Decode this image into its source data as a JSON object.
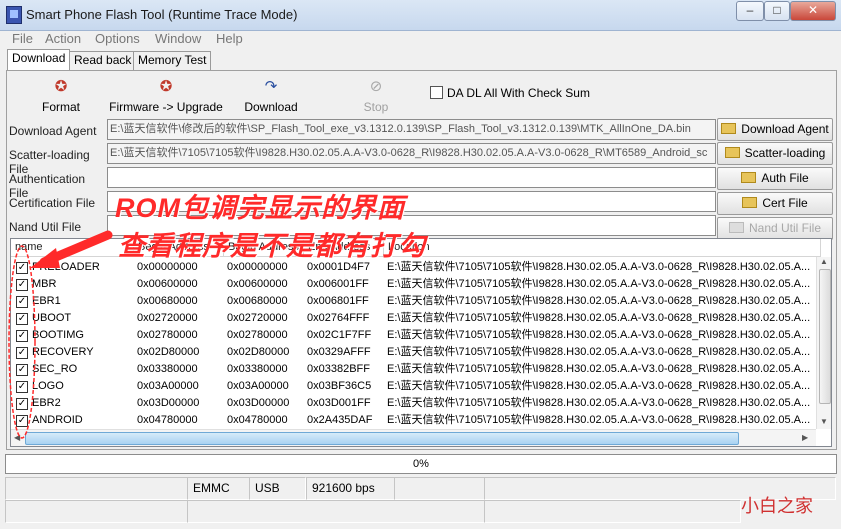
{
  "window": {
    "title": "Smart Phone Flash Tool (Runtime Trace Mode)"
  },
  "menu": [
    "File",
    "Action",
    "Options",
    "Window",
    "Help"
  ],
  "tabs": [
    "Download",
    "Read back",
    "Memory Test"
  ],
  "toolbar": {
    "format": "Format",
    "firmware_upgrade": "Firmware -> Upgrade",
    "download": "Download",
    "stop": "Stop",
    "da_checkbox": "DA DL All With Check Sum",
    "da_checked": false
  },
  "fields": {
    "download_agent": {
      "label": "Download Agent",
      "value": "E:\\蓝天信软件\\修改后的软件\\SP_Flash_Tool_exe_v3.1312.0.139\\SP_Flash_Tool_v3.1312.0.139\\MTK_AllInOne_DA.bin",
      "button": "Download Agent"
    },
    "scatter": {
      "label": "Scatter-loading File",
      "value": "E:\\蓝天信软件\\7105\\7105软件\\I9828.H30.02.05.A.A-V3.0-0628_R\\I9828.H30.02.05.A.A-V3.0-0628_R\\MT6589_Android_sc",
      "button": "Scatter-loading"
    },
    "auth": {
      "label": "Authentication File",
      "value": "",
      "button": "Auth File"
    },
    "cert": {
      "label": "Certification File",
      "value": "",
      "button": "Cert File"
    },
    "nand": {
      "label": "Nand Util File",
      "value": "",
      "button": "Nand Util File"
    }
  },
  "table": {
    "headers": [
      "name",
      "Begin Address",
      "Begin Address",
      "End Address",
      "Location"
    ],
    "rows": [
      {
        "name": "PRELOADER",
        "a1": "0x00000000",
        "a2": "0x00000000",
        "end": "0x0001D4F7",
        "loc": "E:\\蓝天信软件\\7105\\7105软件\\I9828.H30.02.05.A.A-V3.0-0628_R\\I9828.H30.02.05.A..."
      },
      {
        "name": "MBR",
        "a1": "0x00600000",
        "a2": "0x00600000",
        "end": "0x006001FF",
        "loc": "E:\\蓝天信软件\\7105\\7105软件\\I9828.H30.02.05.A.A-V3.0-0628_R\\I9828.H30.02.05.A..."
      },
      {
        "name": "EBR1",
        "a1": "0x00680000",
        "a2": "0x00680000",
        "end": "0x006801FF",
        "loc": "E:\\蓝天信软件\\7105\\7105软件\\I9828.H30.02.05.A.A-V3.0-0628_R\\I9828.H30.02.05.A..."
      },
      {
        "name": "UBOOT",
        "a1": "0x02720000",
        "a2": "0x02720000",
        "end": "0x02764FFF",
        "loc": "E:\\蓝天信软件\\7105\\7105软件\\I9828.H30.02.05.A.A-V3.0-0628_R\\I9828.H30.02.05.A..."
      },
      {
        "name": "BOOTIMG",
        "a1": "0x02780000",
        "a2": "0x02780000",
        "end": "0x02C1F7FF",
        "loc": "E:\\蓝天信软件\\7105\\7105软件\\I9828.H30.02.05.A.A-V3.0-0628_R\\I9828.H30.02.05.A..."
      },
      {
        "name": "RECOVERY",
        "a1": "0x02D80000",
        "a2": "0x02D80000",
        "end": "0x0329AFFF",
        "loc": "E:\\蓝天信软件\\7105\\7105软件\\I9828.H30.02.05.A.A-V3.0-0628_R\\I9828.H30.02.05.A..."
      },
      {
        "name": "SEC_RO",
        "a1": "0x03380000",
        "a2": "0x03380000",
        "end": "0x03382BFF",
        "loc": "E:\\蓝天信软件\\7105\\7105软件\\I9828.H30.02.05.A.A-V3.0-0628_R\\I9828.H30.02.05.A..."
      },
      {
        "name": "LOGO",
        "a1": "0x03A00000",
        "a2": "0x03A00000",
        "end": "0x03BF36C5",
        "loc": "E:\\蓝天信软件\\7105\\7105软件\\I9828.H30.02.05.A.A-V3.0-0628_R\\I9828.H30.02.05.A..."
      },
      {
        "name": "EBR2",
        "a1": "0x03D00000",
        "a2": "0x03D00000",
        "end": "0x03D001FF",
        "loc": "E:\\蓝天信软件\\7105\\7105软件\\I9828.H30.02.05.A.A-V3.0-0628_R\\I9828.H30.02.05.A..."
      },
      {
        "name": "ANDROID",
        "a1": "0x04780000",
        "a2": "0x04780000",
        "end": "0x2A435DAF",
        "loc": "E:\\蓝天信软件\\7105\\7105软件\\I9828.H30.02.05.A.A-V3.0-0628_R\\I9828.H30.02.05.A..."
      }
    ]
  },
  "progress": "0%",
  "status": {
    "storage": "EMMC",
    "port": "USB",
    "baud": "921600 bps"
  },
  "annotation": {
    "line1": "ROM包调完显示的界面",
    "line2": "查看程序是不是都有打勾",
    "color": "#ff2a2a"
  },
  "watermark": "小白之家"
}
